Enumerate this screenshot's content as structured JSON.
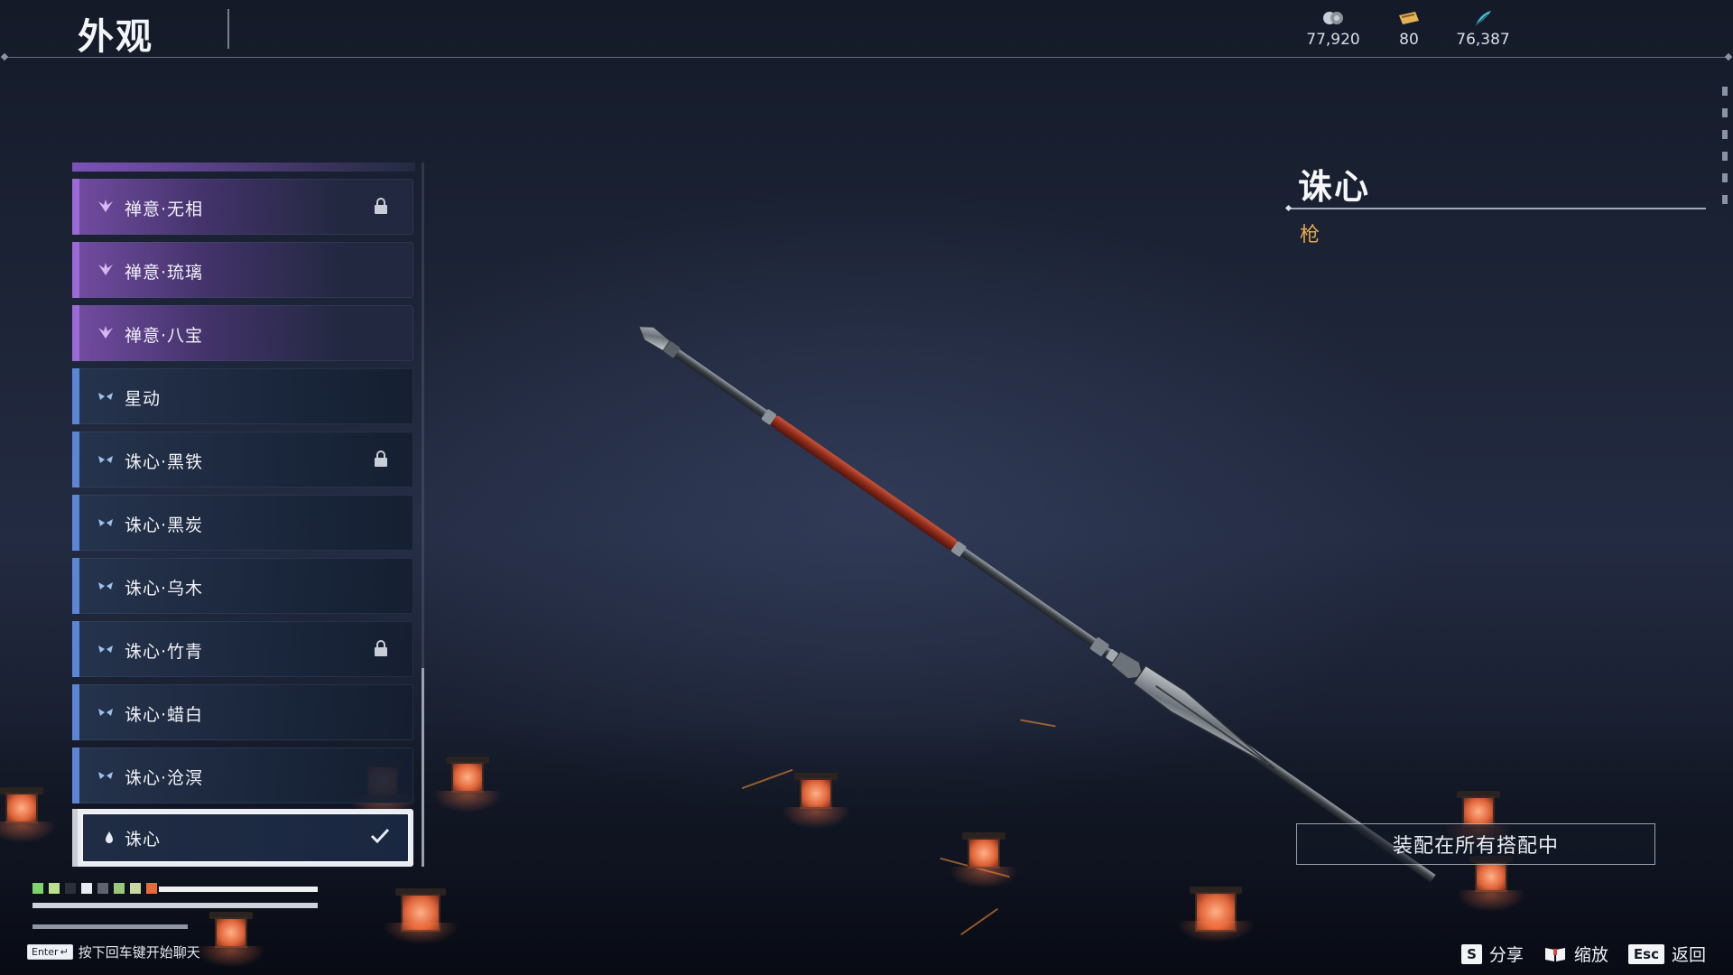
{
  "header": {
    "title": "外观",
    "currencies": [
      {
        "icon": "coin-icon",
        "value": "77,920"
      },
      {
        "icon": "ticket-icon",
        "value": "80"
      },
      {
        "icon": "feather-icon",
        "value": "76,387"
      }
    ]
  },
  "list": {
    "items": [
      {
        "label": "禅意·无相",
        "rarity": "purple",
        "locked": true
      },
      {
        "label": "禅意·琉璃",
        "rarity": "purple",
        "locked": false
      },
      {
        "label": "禅意·八宝",
        "rarity": "purple",
        "locked": false
      },
      {
        "label": "星动",
        "rarity": "blue",
        "locked": false
      },
      {
        "label": "诛心·黑铁",
        "rarity": "blue",
        "locked": true
      },
      {
        "label": "诛心·黑炭",
        "rarity": "blue",
        "locked": false
      },
      {
        "label": "诛心·乌木",
        "rarity": "blue",
        "locked": false
      },
      {
        "label": "诛心·竹青",
        "rarity": "blue",
        "locked": true
      },
      {
        "label": "诛心·蜡白",
        "rarity": "blue",
        "locked": false
      },
      {
        "label": "诛心·沧溟",
        "rarity": "blue",
        "locked": false
      },
      {
        "label": "诛心",
        "rarity": "white",
        "locked": false,
        "selected": true,
        "equipped": true
      }
    ]
  },
  "detail": {
    "name": "诛心",
    "type": "枪",
    "equip_all_label": "装配在所有搭配中"
  },
  "chat": {
    "enter_key": "Enter",
    "hint": "按下回车键开始聊天"
  },
  "hints": [
    {
      "key": "S",
      "label": "分享"
    },
    {
      "key_icon": "book-icon",
      "label": "缩放"
    },
    {
      "key": "Esc",
      "label": "返回"
    }
  ],
  "colors": {
    "purple_accent": "#9b6ad6",
    "blue_accent": "#5b86d6",
    "type_gold": "#e3a84a"
  }
}
